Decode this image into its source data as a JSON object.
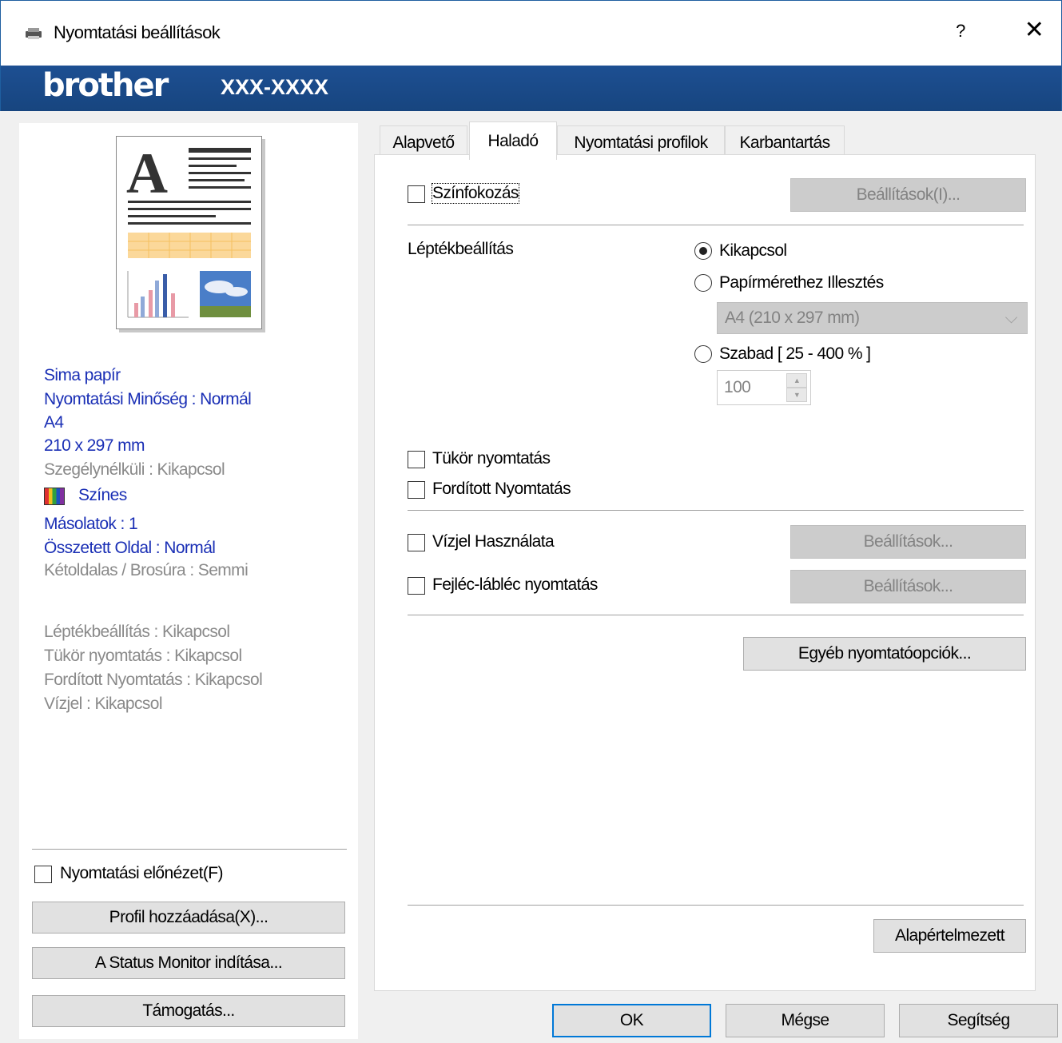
{
  "window": {
    "title": "Nyomtatási beállítások",
    "help": "?",
    "close": "✕"
  },
  "banner": {
    "brand": "brother",
    "model": "XXX-XXXX"
  },
  "summary": {
    "blue_lines": [
      "Sima papír",
      "Nyomtatási Minőség : Normál",
      "A4",
      "210 x 297 mm"
    ],
    "borderless": "Szegélynélküli : Kikapcsol",
    "color": "Színes",
    "copies": "Másolatok : 1",
    "multipage": "Összetett Oldal : Normál",
    "duplex": "Kétoldalas / Brosúra : Semmi",
    "gray_lines": [
      "Léptékbeállítás : Kikapcsol",
      "Tükör nyomtatás : Kikapcsol",
      "Fordított Nyomtatás : Kikapcsol",
      "Vízjel : Kikapcsol"
    ]
  },
  "left_controls": {
    "print_preview": "Nyomtatási előnézet(F)",
    "add_profile": "Profil hozzáadása(X)...",
    "status_monitor": "A Status Monitor indítása...",
    "support": "Támogatás..."
  },
  "tabs": [
    {
      "label": "Alapvető"
    },
    {
      "label": "Haladó",
      "active": true
    },
    {
      "label": "Nyomtatási profilok"
    },
    {
      "label": "Karbantartás"
    }
  ],
  "advanced": {
    "color_enhance": {
      "label": "Színfokozás",
      "checked": false,
      "settings": "Beállítások(I)..."
    },
    "scaling": {
      "label": "Léptékbeállítás",
      "off": "Kikapcsol",
      "fit": "Papírmérethez Illesztés",
      "paper_size": "A4 (210 x 297 mm)",
      "free": "Szabad [ 25 - 400 % ]",
      "percent": "100",
      "selected": "off"
    },
    "mirror": {
      "label": "Tükör nyomtatás",
      "checked": false
    },
    "reverse": {
      "label": "Fordított Nyomtatás",
      "checked": false
    },
    "watermark": {
      "label": "Vízjel Használata",
      "checked": false,
      "settings": "Beállítások..."
    },
    "header_footer": {
      "label": "Fejléc-lábléc nyomtatás",
      "checked": false,
      "settings": "Beállítások..."
    },
    "other_options": "Egyéb nyomtatóopciók...",
    "default": "Alapértelmezett"
  },
  "footer": {
    "ok": "OK",
    "cancel": "Mégse",
    "help": "Segítség"
  },
  "colors": {
    "banner": "#1d4f92",
    "summary_text": "#1a2fb5"
  }
}
